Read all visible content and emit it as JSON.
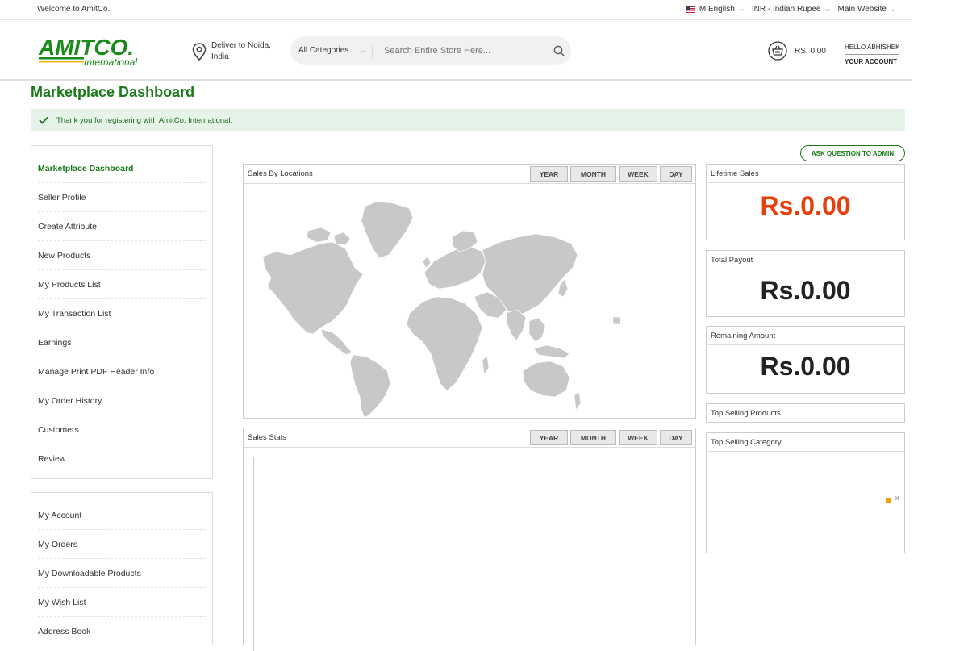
{
  "topbar": {
    "welcome": "Welcome to AmitCo.",
    "language": "M English",
    "currency": "INR - Indian Rupee",
    "website": "Main Website"
  },
  "header": {
    "logo_main": "AMITCO.",
    "logo_sub": "International",
    "deliver_line1": "Deliver to Noida,",
    "deliver_line2": "India",
    "category_select": "All Categories",
    "search_placeholder": "Search Entire Store Here...",
    "cart_total": "RS. 0.00",
    "hello": "HELLO ABHISHEK",
    "your_account": "YOUR ACCOUNT"
  },
  "page": {
    "title": "Marketplace Dashboard",
    "notice": "Thank you for registering with AmitCo. International."
  },
  "sidebar_main": [
    {
      "label": "Marketplace Dashboard",
      "active": true
    },
    {
      "label": "Seller Profile"
    },
    {
      "label": "Create Attribute"
    },
    {
      "label": "New Products"
    },
    {
      "label": "My Products List"
    },
    {
      "label": "My Transaction List"
    },
    {
      "label": "Earnings"
    },
    {
      "label": "Manage Print PDF Header Info"
    },
    {
      "label": "My Order History"
    },
    {
      "label": "Customers"
    },
    {
      "label": "Review"
    }
  ],
  "sidebar_account": [
    {
      "label": "My Account"
    },
    {
      "label": "My Orders"
    },
    {
      "label": "My Downloadable Products"
    },
    {
      "label": "My Wish List"
    },
    {
      "label": "Address Book"
    }
  ],
  "ask_button": "ASK QUESTION TO ADMIN",
  "sales_locations": {
    "title": "Sales By Locations",
    "buttons": [
      "YEAR",
      "MONTH",
      "WEEK",
      "DAY"
    ]
  },
  "sales_stats": {
    "title": "Sales Stats",
    "buttons": [
      "YEAR",
      "MONTH",
      "WEEK",
      "DAY"
    ]
  },
  "stats": {
    "lifetime_label": "Lifetime Sales",
    "lifetime_value": "Rs.0.00",
    "payout_label": "Total Payout",
    "payout_value": "Rs.0.00",
    "remaining_label": "Remaining Amount",
    "remaining_value": "Rs.0.00",
    "top_products_label": "Top Selling Products",
    "top_category_label": "Top Selling Category",
    "category_legend": "%"
  },
  "colors": {
    "brand_green": "#1a7a1a",
    "lifetime_red": "#e8400c",
    "legend_orange": "#f59d00",
    "map_gray": "#c8c8c8"
  }
}
